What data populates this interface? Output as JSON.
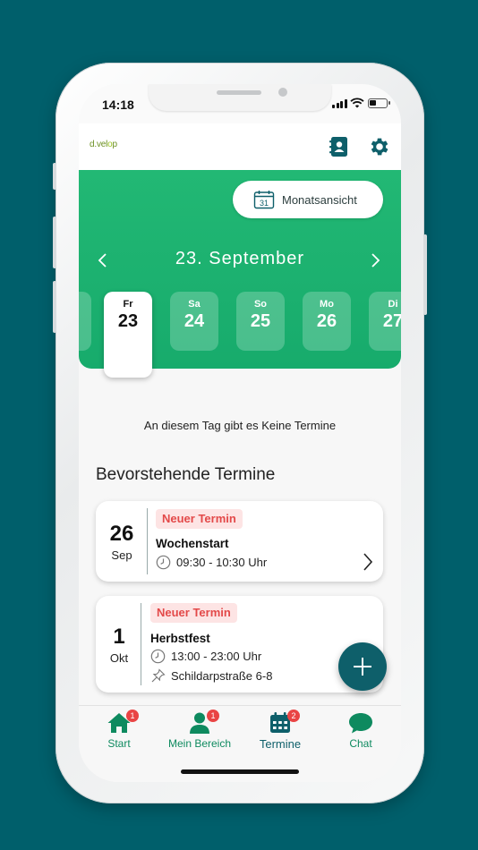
{
  "status_bar": {
    "time": "14:18"
  },
  "header": {
    "logo_text_a": "d.",
    "logo_text_b": "vel",
    "logo_text_c": "o",
    "logo_text_d": "p",
    "contacts_icon": "contacts-icon",
    "settings_icon": "gear-icon"
  },
  "calendar": {
    "month_view_label": "Monatsansicht",
    "date_title": "23. September",
    "days": [
      {
        "name": "Fr",
        "date": "23",
        "selected": true
      },
      {
        "name": "Sa",
        "date": "24"
      },
      {
        "name": "So",
        "date": "25"
      },
      {
        "name": "Mo",
        "date": "26"
      },
      {
        "name": "Di",
        "date": "27"
      }
    ]
  },
  "no_events_text": "An diesem Tag gibt es Keine Termine",
  "upcoming": {
    "title": "Bevorstehende Termine",
    "events": [
      {
        "day": "26",
        "month": "Sep",
        "badge": "Neuer Termin",
        "title": "Wochenstart",
        "time": "09:30 - 10:30 Uhr"
      },
      {
        "day": "1",
        "month": "Okt",
        "badge": "Neuer Termin",
        "title": "Herbstfest",
        "time": "13:00 - 23:00 Uhr",
        "location": "Schildarpstraße 6-8"
      }
    ]
  },
  "tabs": [
    {
      "label": "Start",
      "icon": "home-icon",
      "badge": "1"
    },
    {
      "label": "Mein Bereich",
      "icon": "person-icon",
      "badge": "1"
    },
    {
      "label": "Termine",
      "icon": "calendar-icon",
      "badge": "2",
      "active": true
    },
    {
      "label": "Chat",
      "icon": "chat-bubble-icon"
    }
  ],
  "colors": {
    "background": "#005f6b",
    "green": "#1db271",
    "teal": "#0e5f6a",
    "badge_red": "#e34949"
  }
}
